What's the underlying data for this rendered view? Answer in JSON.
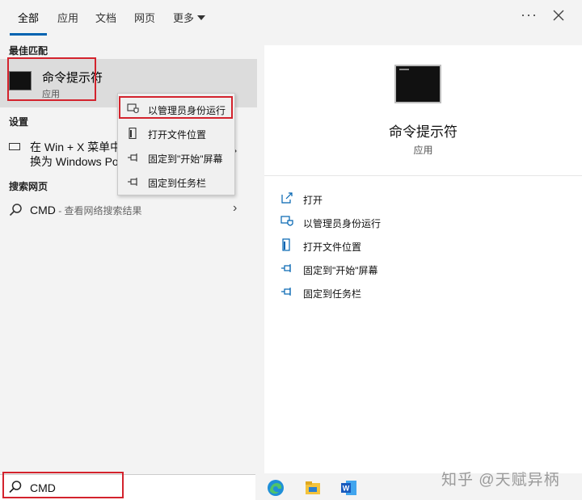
{
  "tabs": [
    {
      "label": "全部",
      "active": true
    },
    {
      "label": "应用"
    },
    {
      "label": "文档"
    },
    {
      "label": "网页"
    },
    {
      "label": "更多"
    }
  ],
  "topbar": {
    "more_icon": "more-options-icon",
    "close_icon": "close-icon"
  },
  "best_match": {
    "heading": "最佳匹配",
    "title": "命令提示符",
    "subtitle": "应用"
  },
  "settings": {
    "heading": "设置",
    "line1": "在 Win + X 菜单中",
    "line2": "换为 Windows Po"
  },
  "web": {
    "heading": "搜索网页",
    "term": "CMD",
    "suffix": " - 查看网络搜索结果"
  },
  "context_menu": [
    {
      "label": "以管理员身份运行",
      "icon": "shield-run-icon"
    },
    {
      "label": "打开文件位置",
      "icon": "file-location-icon"
    },
    {
      "label": "固定到\"开始\"屏幕",
      "icon": "pin-icon"
    },
    {
      "label": "固定到任务栏",
      "icon": "pin-icon"
    }
  ],
  "preview": {
    "title": "命令提示符",
    "subtitle": "应用",
    "actions": [
      {
        "label": "打开",
        "icon": "open-icon"
      },
      {
        "label": "以管理员身份运行",
        "icon": "shield-run-icon"
      },
      {
        "label": "打开文件位置",
        "icon": "file-location-icon"
      },
      {
        "label": "固定到\"开始\"屏幕",
        "icon": "pin-icon"
      },
      {
        "label": "固定到任务栏",
        "icon": "pin-icon"
      }
    ]
  },
  "search": {
    "value": "CMD"
  },
  "taskbar": {
    "apps": [
      "edge-icon",
      "file-explorer-icon",
      "word-icon"
    ]
  },
  "watermark": "知乎 @天赋异柄",
  "colors": {
    "accent": "#0063b1",
    "highlight_box": "#d3232d",
    "selected_bg": "#dcdcdc"
  }
}
